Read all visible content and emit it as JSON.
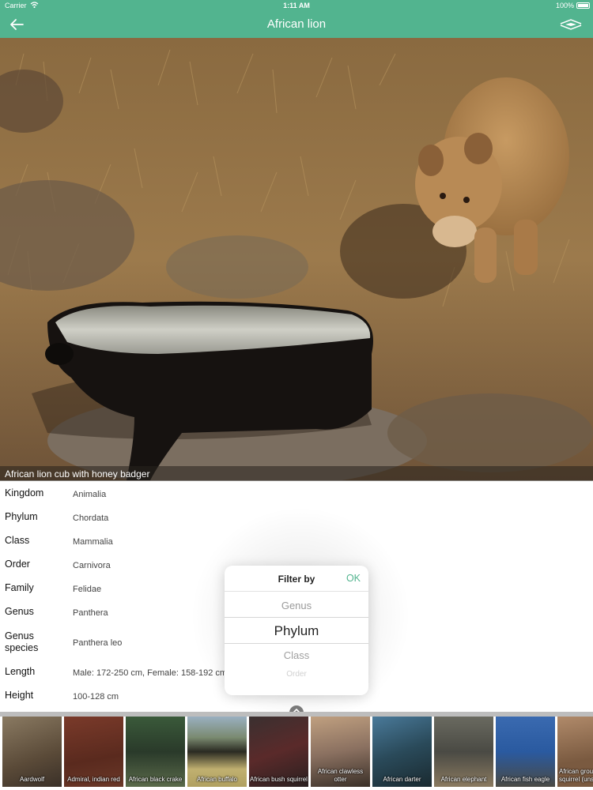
{
  "status_bar": {
    "carrier": "Carrier",
    "time": "1:11 AM",
    "battery": "100%"
  },
  "nav": {
    "title": "African lion",
    "back_icon": "back-arrow-icon",
    "menu_icon": "double-chevron-icon"
  },
  "photo": {
    "caption": "African lion cub with honey badger"
  },
  "taxonomy": [
    {
      "key": "Kingdom",
      "value": "Animalia"
    },
    {
      "key": "Phylum",
      "value": "Chordata"
    },
    {
      "key": "Class",
      "value": "Mammalia"
    },
    {
      "key": "Order",
      "value": "Carnivora"
    },
    {
      "key": "Family",
      "value": "Felidae"
    },
    {
      "key": "Genus",
      "value": "Panthera"
    },
    {
      "key": "Genus species",
      "value": "Panthera leo"
    },
    {
      "key": "Length",
      "value": "Male: 172-250 cm, Female: 158-192 cm"
    },
    {
      "key": "Height",
      "value": "100-128 cm"
    }
  ],
  "filter": {
    "title": "Filter by",
    "ok_label": "OK",
    "options": [
      "Genus",
      "Phylum",
      "Class",
      "Order"
    ],
    "selected": "Phylum"
  },
  "thumbnails": [
    {
      "label": "Aardwolf"
    },
    {
      "label": "Admiral, indian red"
    },
    {
      "label": "African black crake"
    },
    {
      "label": "African buffalo"
    },
    {
      "label": "African bush squirrel"
    },
    {
      "label": "African clawless otter"
    },
    {
      "label": "African darter"
    },
    {
      "label": "African elephant"
    },
    {
      "label": "African fish eagle"
    },
    {
      "label": "African ground squirrel (unst"
    }
  ],
  "colors": {
    "accent": "#52b48f"
  }
}
